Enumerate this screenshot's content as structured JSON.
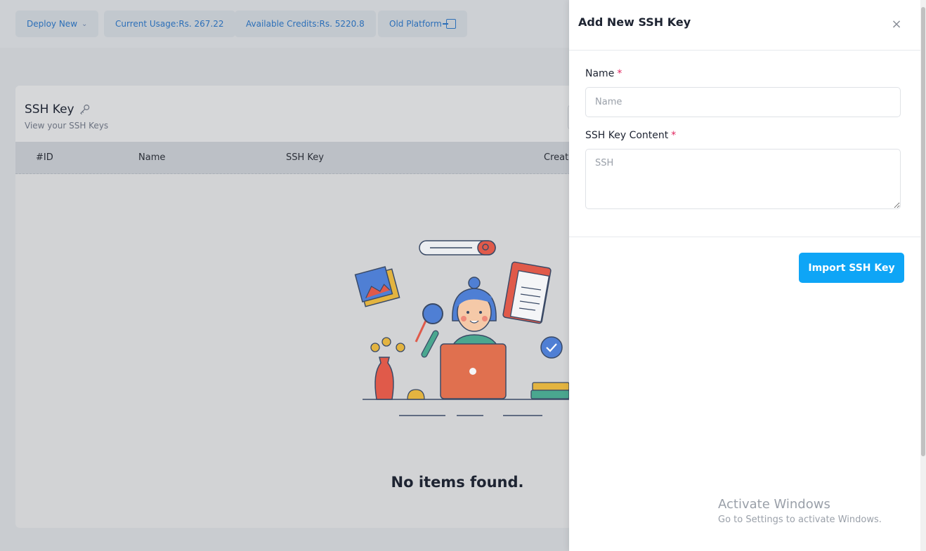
{
  "topbar": {
    "deploy_label": "Deploy New",
    "usage_label": "Current Usage:Rs. 267.22",
    "credits_label": "Available Credits:Rs. 5220.8",
    "old_platform_label": "Old Platform"
  },
  "card": {
    "title": "SSH Key",
    "subtitle": "View your SSH Keys",
    "columns": [
      "#ID",
      "Name",
      "SSH Key",
      "Creat"
    ],
    "empty_text": "No items found."
  },
  "drawer": {
    "title": "Add New SSH Key",
    "close_glyph": "×",
    "name_label": "Name",
    "required_mark": "*",
    "name_placeholder": "Name",
    "ssh_label": "SSH Key Content",
    "ssh_placeholder": "SSH",
    "submit_label": "Import SSH Key"
  },
  "watermark": {
    "line1": "Activate Windows",
    "line2": "Go to Settings to activate Windows."
  },
  "colors": {
    "accent": "#0ea5f6",
    "link": "#2c6fb8",
    "required": "#e0245e"
  },
  "icons": [
    "chevron-down-icon",
    "external-link-icon",
    "key-icon",
    "close-icon"
  ]
}
